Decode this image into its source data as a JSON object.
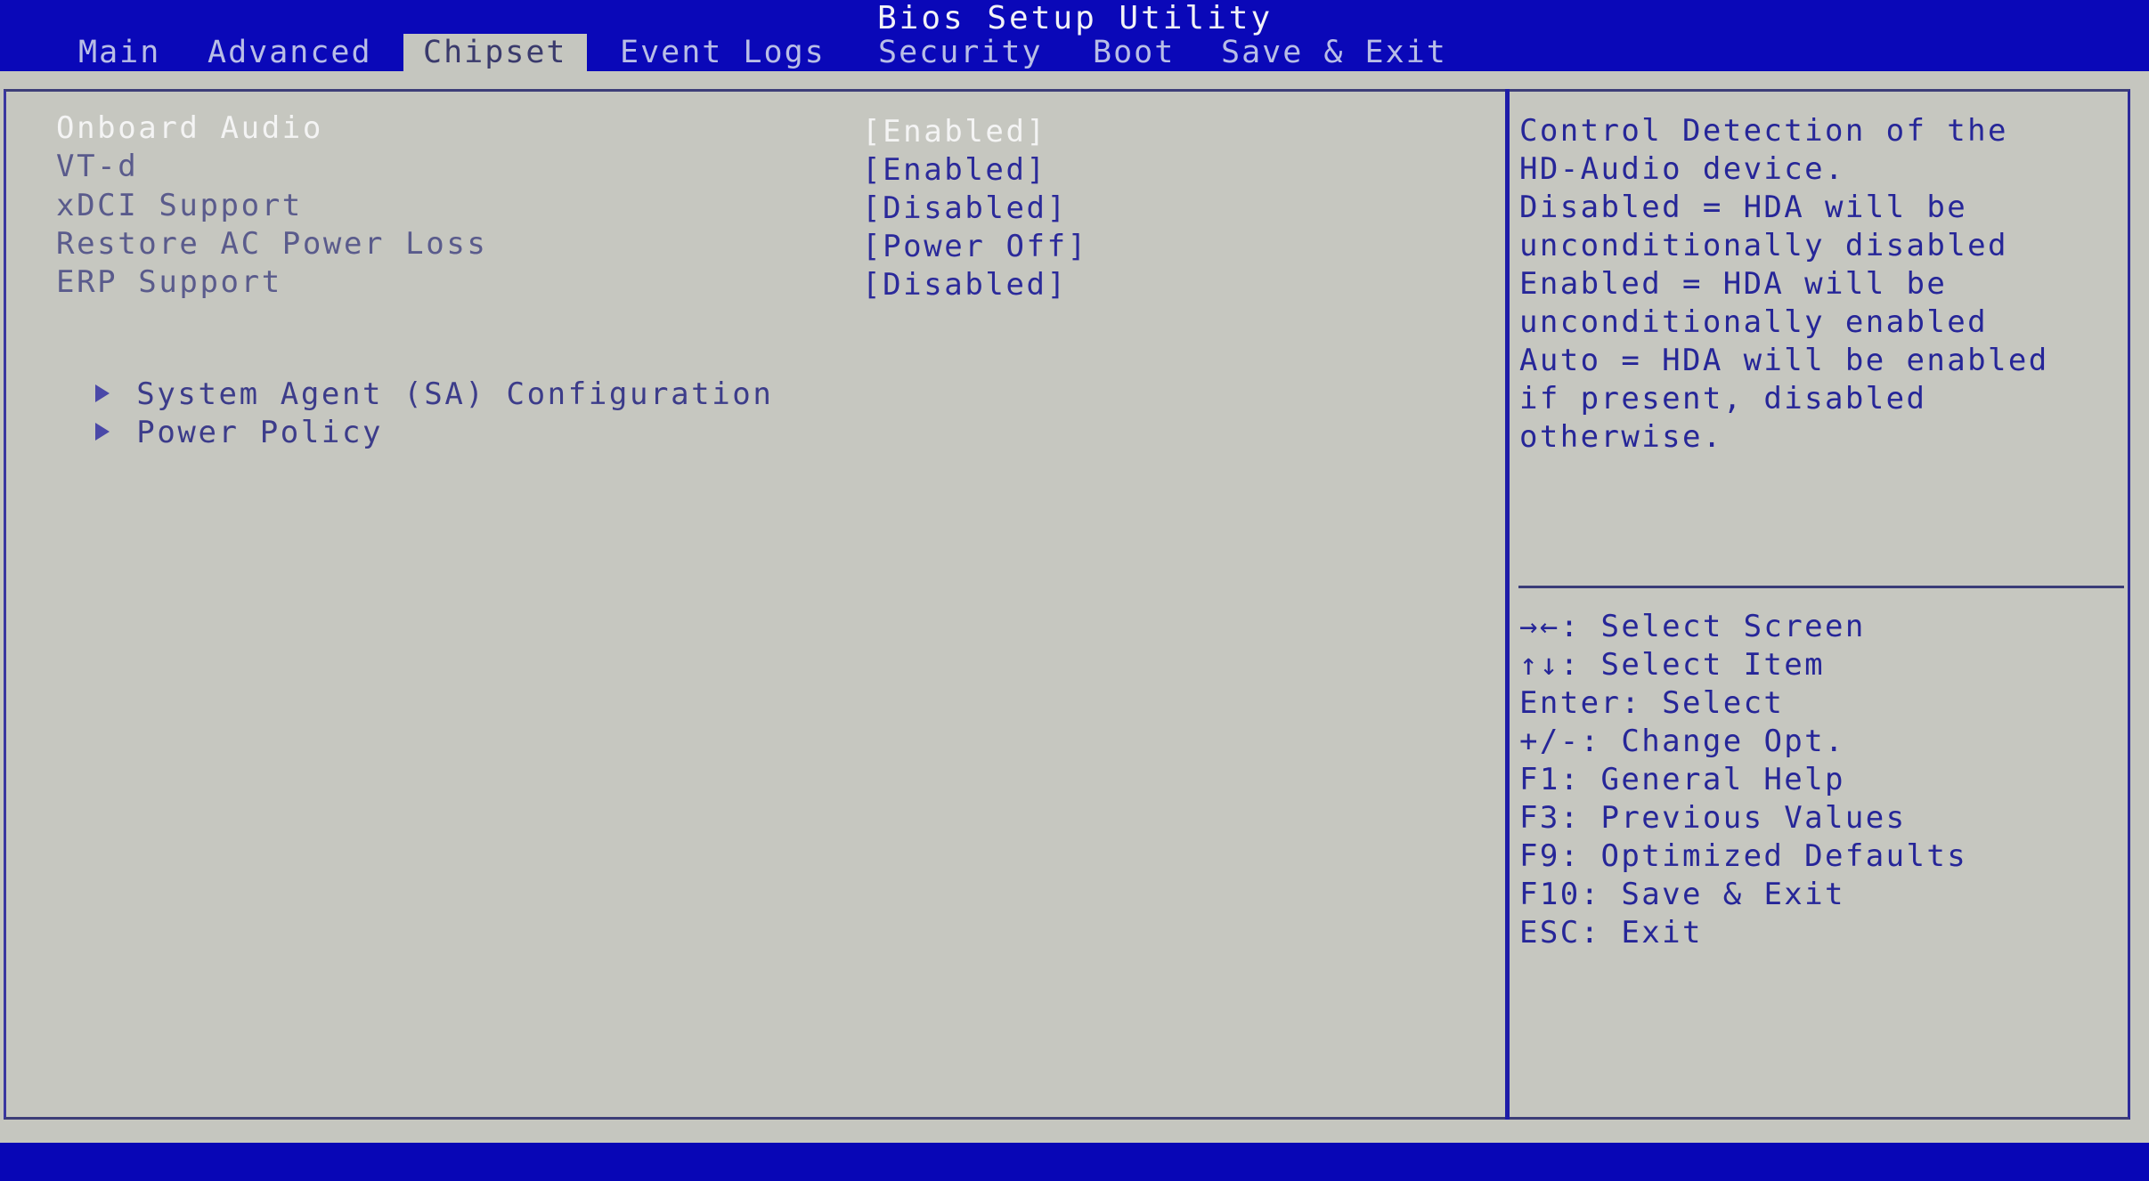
{
  "header": {
    "title": "Bios Setup Utility"
  },
  "tabs": [
    {
      "label": "Main",
      "active": false
    },
    {
      "label": "Advanced",
      "active": false
    },
    {
      "label": "Chipset",
      "active": true
    },
    {
      "label": "Event Logs",
      "active": false
    },
    {
      "label": "Security",
      "active": false
    },
    {
      "label": "Boot",
      "active": false
    },
    {
      "label": "Save & Exit",
      "active": false
    }
  ],
  "settings": [
    {
      "label": "Onboard Audio",
      "value": "[Enabled]",
      "selected": true
    },
    {
      "label": "VT-d",
      "value": "[Enabled]",
      "selected": false
    },
    {
      "label": "xDCI Support",
      "value": "[Disabled]",
      "selected": false
    },
    {
      "label": "Restore AC Power Loss",
      "value": "[Power Off]",
      "selected": false
    },
    {
      "label": "ERP Support",
      "value": "[Disabled]",
      "selected": false
    }
  ],
  "submenus": [
    {
      "label": "System Agent (SA) Configuration",
      "icon": "triangle-right-icon"
    },
    {
      "label": "Power Policy",
      "icon": "triangle-right-icon"
    }
  ],
  "help": {
    "lines": [
      "Control Detection of the",
      "HD-Audio device.",
      "Disabled = HDA will be",
      "unconditionally disabled",
      "Enabled = HDA will be",
      "unconditionally enabled",
      "Auto = HDA will be enabled",
      "if present, disabled",
      "otherwise."
    ]
  },
  "keys": [
    {
      "key": "→←:",
      "action": " Select Screen"
    },
    {
      "key": "↑↓:",
      "action": " Select Item"
    },
    {
      "key": "Enter:",
      "action": " Select"
    },
    {
      "key": "+/-:",
      "action": " Change Opt."
    },
    {
      "key": "F1:",
      "action": " General Help"
    },
    {
      "key": "F3:",
      "action": " Previous Values"
    },
    {
      "key": "F9:",
      "action": " Optimized Defaults"
    },
    {
      "key": "F10:",
      "action": " Save & Exit"
    },
    {
      "key": "ESC:",
      "action": " Exit"
    }
  ],
  "colors": {
    "header_bg": "#0a08b8",
    "panel_bg": "#c5c6bf",
    "text_blue": "#262698",
    "selected_text": "#f4f4f4"
  }
}
